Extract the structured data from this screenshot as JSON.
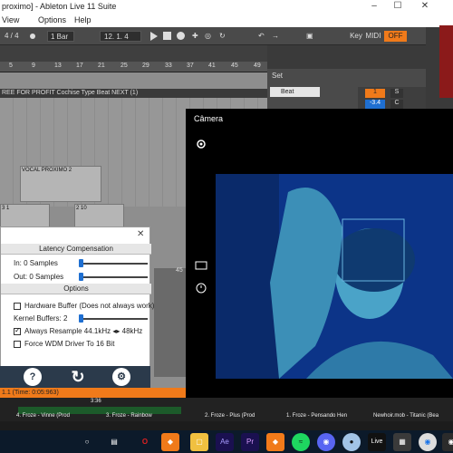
{
  "window": {
    "title": "proximo] - Ableton Live 11 Suite",
    "minimize_icon": "minimize-icon",
    "maximize_icon": "maximize-icon",
    "close_icon": "close-icon"
  },
  "menu": {
    "items": [
      "View",
      "Options",
      "Help"
    ]
  },
  "transport": {
    "signature": "4 / 4",
    "quantize": "1 Bar",
    "position": "12. 1. 4",
    "key_label": "Key",
    "midi_label": "MIDI",
    "off_label": "OFF"
  },
  "ruler": {
    "marks": [
      "5",
      "9",
      "13",
      "17",
      "21",
      "25",
      "29",
      "33",
      "37",
      "41",
      "45",
      "49"
    ]
  },
  "tracks": {
    "header": "REE FOR PROFIT Cochise Type Beat NEXT (1)",
    "clip_vocal": "VOCAL PROXIMO 2",
    "clip_a": "3 1",
    "clip_b": "2 10"
  },
  "set_panel": {
    "title": "Set",
    "track_label": "Beat",
    "num1": "1",
    "s_label": "S",
    "vol": "-3.4",
    "c_label": "C"
  },
  "camera": {
    "title": "Câmera",
    "settings_icon": "gear-icon",
    "photo_icon": "photo-mode-icon",
    "timer_icon": "timer-icon"
  },
  "latency": {
    "header": "Latency Compensation",
    "in_label": "In: 0 Samples",
    "out_label": "Out: 0 Samples",
    "options_header": "Options",
    "hardware_buffer": "Hardware Buffer (Does not always work)",
    "kernel_buffers": "Kernel Buffers: 2",
    "always_resample": "Always Resample 44.1kHz ◂▸ 48kHz",
    "force_wdm": "Force WDM Driver To 16 Bit",
    "close_icon": "close-icon",
    "hardware_buffer_checked": false,
    "always_resample_checked": true,
    "force_wdm_checked": false
  },
  "tools": {
    "help_icon": "help-icon",
    "refresh_icon": "refresh-icon",
    "settings_icon": "gear-icon"
  },
  "status": {
    "text": "1.1 (Time: 0:05:963)",
    "ruler_value": "45",
    "time_mark": "3:36"
  },
  "scenes": [
    "4. Froze - Vinne (Prod",
    "3. Froze - Rainbow",
    "2. Froze - Plus (Prod",
    "1. Froze - Pensando Hen",
    "Newhoir.mob - Titanic (Bea"
  ],
  "taskbar": {
    "icons": [
      "start-icon",
      "search-icon",
      "task-view-icon",
      "opera-icon",
      "fl-studio-icon",
      "file-explorer-icon",
      "after-effects-icon",
      "premiere-icon",
      "fl-studio-icon",
      "spotify-icon",
      "discord-icon",
      "game-icon",
      "ableton-icon",
      "chrome-icon",
      "camera-icon"
    ],
    "ae_label": "Ae",
    "pr_label": "Pr",
    "live_label": "Live"
  }
}
